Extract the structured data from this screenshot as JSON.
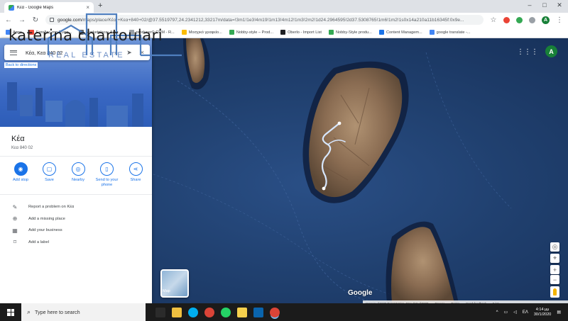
{
  "browser": {
    "tab_title": "Κέα - Google Maps",
    "tab_close": "×",
    "new_tab": "+",
    "window_controls": [
      "–",
      "□",
      "✕"
    ],
    "url_host": "google.com",
    "url_path": "/maps/place/Κέα,+Κεα+840+02/@37.5519797,24.2341212,33217m/data=!3m1!1e3!4m19!1m13!4m12!1m3!2m2!1d24.2964595!2d37.5308765!1m6!1m2!1s0x14a210a11b16345f:0x9e...",
    "profile_initial": "A"
  },
  "bookmarks": [
    {
      "label": "Apps",
      "color": "#4285f4"
    },
    {
      "label": "Εισοδος στο Ευφη...",
      "color": "#ea4335"
    },
    {
      "label": "Marketplace: Διαπ...",
      "color": "#5f6368"
    },
    {
      "label": "producer© CRM - R...",
      "color": "#9aa0a6"
    },
    {
      "label": "Μοσχικό γραφείο...",
      "color": "#fbbc04"
    },
    {
      "label": "Nobby-style – Prod...",
      "color": "#34a853"
    },
    {
      "label": "Oberlo - Import List",
      "color": "#202124"
    },
    {
      "label": "Nobby-Style produ...",
      "color": "#34a853"
    },
    {
      "label": "Content Managem...",
      "color": "#1a73e8"
    },
    {
      "label": "google translate -...",
      "color": "#4285f4"
    }
  ],
  "search": {
    "value": "Κέα, Κεα 840 02",
    "back_to_directions": "Back to directions"
  },
  "place": {
    "name": "Κέα",
    "address": "Κεα 840 02"
  },
  "actions": [
    {
      "label": "Add stop",
      "icon": "add-stop-icon",
      "glyph": "◉"
    },
    {
      "label": "Save",
      "icon": "bookmark-icon",
      "glyph": "▢"
    },
    {
      "label": "Nearby",
      "icon": "nearby-icon",
      "glyph": "◎"
    },
    {
      "label": "Send to your phone",
      "icon": "phone-icon",
      "glyph": "▯"
    },
    {
      "label": "Share",
      "icon": "share-icon",
      "glyph": "⋖"
    }
  ],
  "suggestions": [
    {
      "label": "Report a problem on Κέα",
      "icon": "pencil-icon",
      "glyph": "✎"
    },
    {
      "label": "Add a missing place",
      "icon": "add-place-icon",
      "glyph": "⊕"
    },
    {
      "label": "Add your business",
      "icon": "business-icon",
      "glyph": "▦"
    },
    {
      "label": "Add a label",
      "icon": "label-icon",
      "glyph": "⌑"
    }
  ],
  "watermark": {
    "title": "katerina chartoulari",
    "subtitle": "REAL ESTATE"
  },
  "map": {
    "layer_label": "Map",
    "google_logo": "Google",
    "attribution": [
      "Imagery ©2020 TerraMetrics, Map data ©2020",
      "Greece",
      "Terms",
      "Send feedback",
      "5 km"
    ],
    "profile_initial": "A"
  },
  "taskbar": {
    "search_placeholder": "Type here to search",
    "time": "4:14 μμ",
    "date": "30/1/2020",
    "language": "ΕΛ",
    "apps": [
      {
        "name": "task-view",
        "color": "#2b2b2b"
      },
      {
        "name": "file-explorer",
        "color": "#f0c040"
      },
      {
        "name": "skype",
        "color": "#00aff0"
      },
      {
        "name": "chrome",
        "color": "#db4437"
      },
      {
        "name": "whatsapp",
        "color": "#25d366"
      },
      {
        "name": "sticky-notes",
        "color": "#f6d04d"
      },
      {
        "name": "outlook",
        "color": "#0a64ad"
      },
      {
        "name": "chrome-active",
        "color": "#db4437"
      }
    ]
  },
  "colors": {
    "accent": "#1a73e8",
    "route": "#d7e7ff",
    "sea": "#20406f"
  }
}
